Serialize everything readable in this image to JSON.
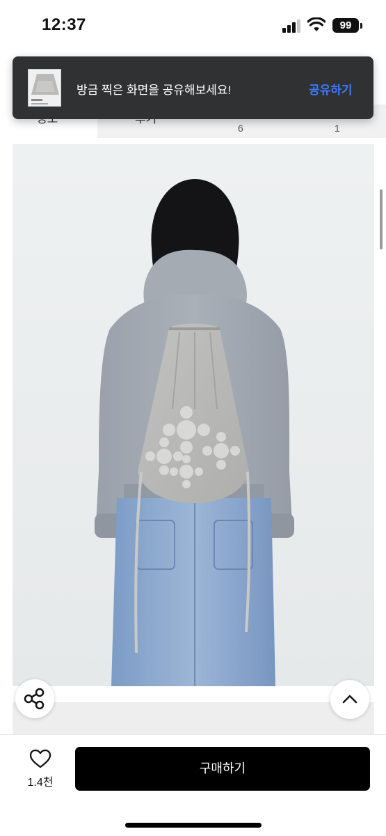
{
  "status_bar": {
    "time": "12:37",
    "battery": "99"
  },
  "tabs": [
    {
      "label": "정보",
      "count": ""
    },
    {
      "label": "후기",
      "count": "6"
    },
    {
      "label": "",
      "count": "1"
    }
  ],
  "toast": {
    "message": "방금 찍은 화면을 공유해보세요!",
    "action": "공유하기"
  },
  "colors": {
    "accent": "#3d78ff",
    "toast_bg": "#303133",
    "buy_bg": "#000000"
  },
  "icons": {
    "share": "share-icon",
    "scroll_top": "chevron-up-icon",
    "like": "heart-icon"
  },
  "bottom_bar": {
    "like_count": "1.4천",
    "buy_label": "구매하기"
  }
}
